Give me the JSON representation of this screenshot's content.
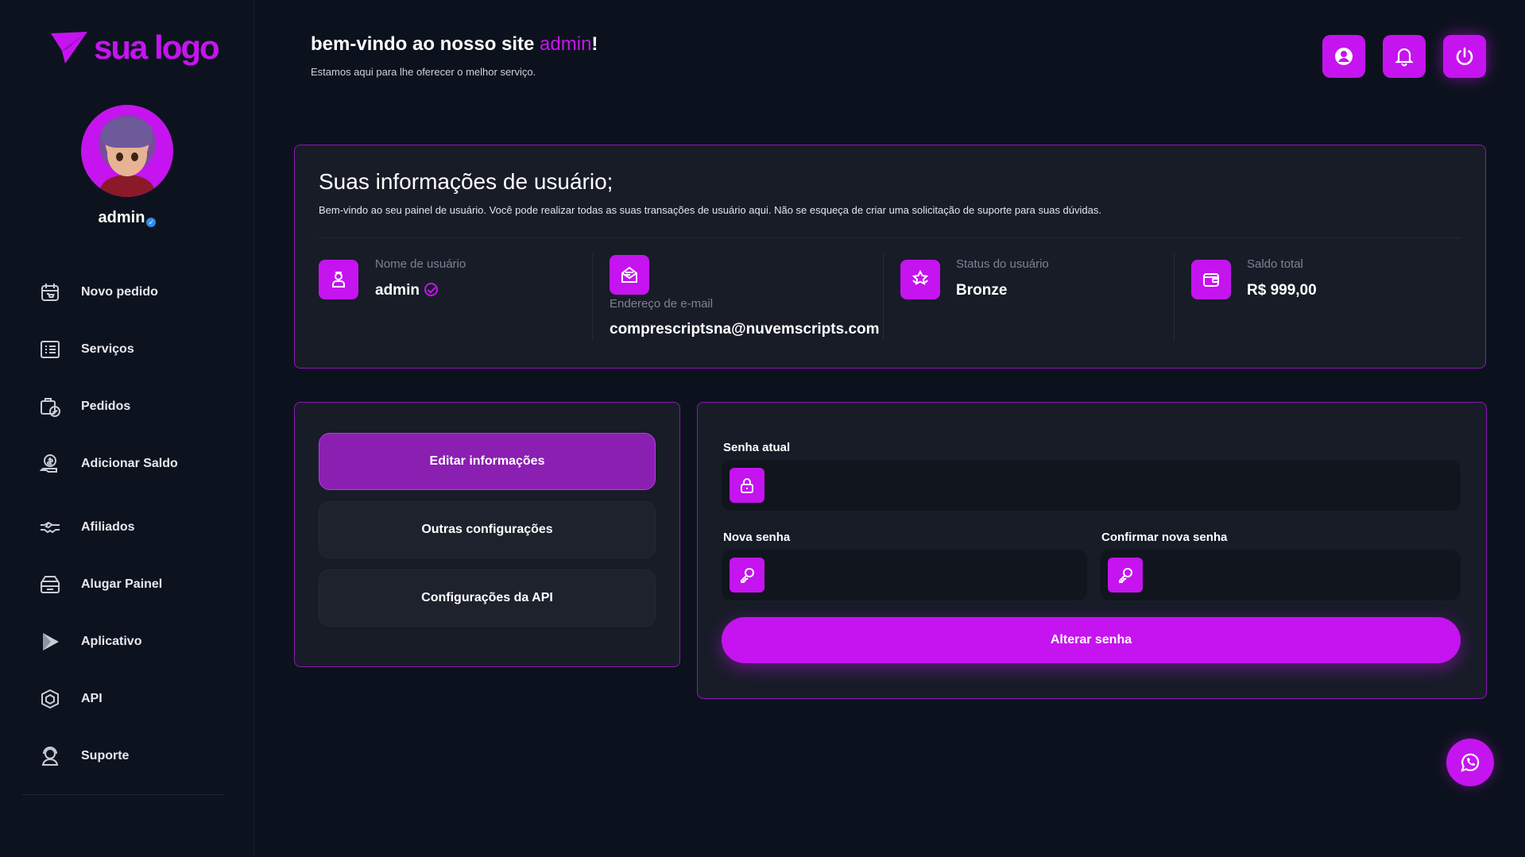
{
  "colors": {
    "accent": "#c514ef",
    "background": "#0c121d",
    "card": "#171c27"
  },
  "sidebar": {
    "logo_text": "sua logo",
    "username": "admin",
    "items": [
      {
        "label": "Novo pedido",
        "icon": "calendar-cart-icon"
      },
      {
        "label": "Serviços",
        "icon": "list-icon"
      },
      {
        "label": "Pedidos",
        "icon": "orders-check-icon"
      },
      {
        "label": "Adicionar Saldo",
        "icon": "money-hand-icon"
      },
      {
        "label": "Afiliados",
        "icon": "handshake-icon"
      },
      {
        "label": "Alugar Painel",
        "icon": "panel-icon"
      },
      {
        "label": "Aplicativo",
        "icon": "play-icon"
      },
      {
        "label": "API",
        "icon": "api-cube-icon"
      },
      {
        "label": "Suporte",
        "icon": "support-icon"
      }
    ]
  },
  "header": {
    "title_prefix": "bem-vindo ao nosso site ",
    "title_user": "admin",
    "title_suffix": "!",
    "subtitle": "Estamos aqui para lhe oferecer o melhor serviço."
  },
  "user_info": {
    "title": "Suas informações de usuário;",
    "description": "Bem-vindo ao seu painel de usuário. Você pode realizar todas as suas transações de usuário aqui. Não se esqueça de criar uma solicitação de suporte para suas dúvidas.",
    "username_label": "Nome de usuário",
    "username_value": "admin",
    "email_label": "Endereço de e-mail",
    "email_value": "comprescriptsna@nuvemscripts.com",
    "status_label": "Status do usuário",
    "status_value": "Bronze",
    "balance_label": "Saldo total",
    "balance_value": "R$ 999,00"
  },
  "settings_menu": {
    "items": [
      {
        "label": "Editar informações",
        "active": true
      },
      {
        "label": "Outras configurações",
        "active": false
      },
      {
        "label": "Configurações da API",
        "active": false
      }
    ]
  },
  "password_form": {
    "current_label": "Senha atual",
    "current_value": "",
    "new_label": "Nova senha",
    "new_value": "",
    "confirm_label": "Confirmar nova senha",
    "confirm_value": "",
    "submit_label": "Alterar senha"
  }
}
